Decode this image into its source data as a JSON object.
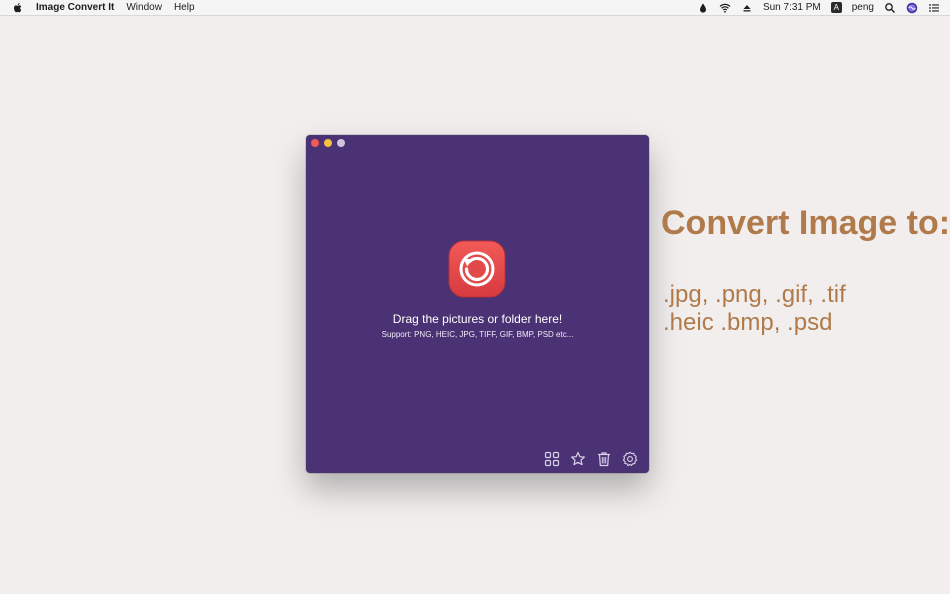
{
  "menubar": {
    "app_name": "Image Convert It",
    "menus": [
      "Window",
      "Help"
    ],
    "time": "Sun 7:31 PM",
    "input_source": "A",
    "user": "peng",
    "icons": [
      "apple-icon",
      "drop-icon",
      "wifi-icon",
      "eject-icon",
      "input-source-icon",
      "spotlight-icon",
      "siri-icon",
      "notification-center-icon"
    ]
  },
  "window": {
    "drop_title": "Drag the pictures or folder here!",
    "drop_support": "Support: PNG, HEIC, JPG, TIFF, GIF, BMP, PSD etc...",
    "toolbar_icons": [
      "grid-icon",
      "star-icon",
      "trash-icon",
      "settings-icon"
    ],
    "background_color": "#4a3274",
    "logo_color": "#e24a4a"
  },
  "promo": {
    "heading": "Convert Image to:",
    "line1": ".jpg,  .png,  .gif,  .tif",
    "line2": ".heic  .bmp,  .psd",
    "color": "#b07a4a"
  }
}
